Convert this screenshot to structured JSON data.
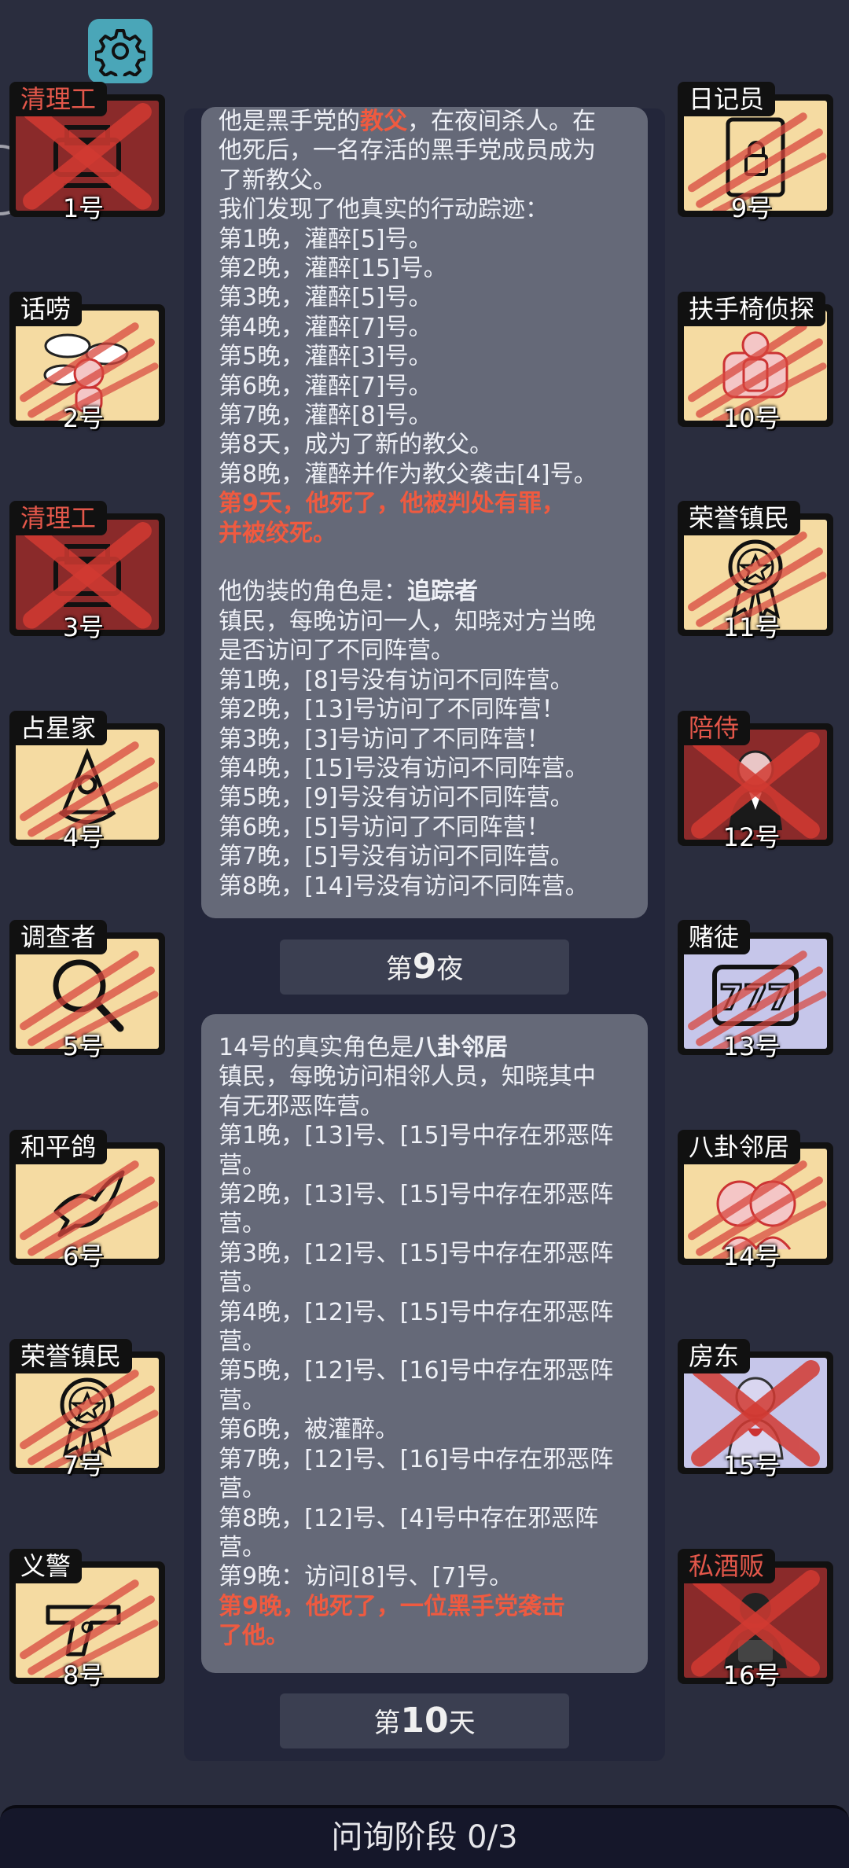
{
  "colors": {
    "background": "#2a2d3e",
    "bubble": "#656978",
    "accent_red": "#ef5a40",
    "card_bg": "#f5dba2"
  },
  "settings": {
    "icon": "gear-icon"
  },
  "left_players": [
    {
      "role": "清理工",
      "number": "1号",
      "icon": "cleaner-machine-icon",
      "dead": true,
      "role_red": true
    },
    {
      "role": "话唠",
      "number": "2号",
      "icon": "chatterbox-icon",
      "dead": false,
      "role_red": false
    },
    {
      "role": "清理工",
      "number": "3号",
      "icon": "cleaner-machine-icon",
      "dead": true,
      "role_red": true
    },
    {
      "role": "占星家",
      "number": "4号",
      "icon": "sextant-icon",
      "dead": false,
      "role_red": false
    },
    {
      "role": "调查者",
      "number": "5号",
      "icon": "magnifier-icon",
      "dead": false,
      "role_red": false
    },
    {
      "role": "和平鸽",
      "number": "6号",
      "icon": "dove-icon",
      "dead": false,
      "role_red": false
    },
    {
      "role": "荣誉镇民",
      "number": "7号",
      "icon": "medal-icon",
      "dead": false,
      "role_red": false
    },
    {
      "role": "义警",
      "number": "8号",
      "icon": "pistol-icon",
      "dead": false,
      "role_red": false
    }
  ],
  "right_players": [
    {
      "role": "日记员",
      "number": "9号",
      "icon": "diary-lock-icon",
      "dead": false,
      "role_red": false
    },
    {
      "role": "扶手椅侦探",
      "number": "10号",
      "icon": "armchair-icon",
      "dead": false,
      "role_red": false
    },
    {
      "role": "荣誉镇民",
      "number": "11号",
      "icon": "medal-icon",
      "dead": false,
      "role_red": false
    },
    {
      "role": "陪侍",
      "number": "12号",
      "icon": "escort-icon",
      "dead": true,
      "role_red": true
    },
    {
      "role": "赌徒",
      "number": "13号",
      "icon": "slot-777-icon",
      "dead": false,
      "role_red": false
    },
    {
      "role": "八卦邻居",
      "number": "14号",
      "icon": "gossip-icon",
      "dead": false,
      "role_red": false
    },
    {
      "role": "房东",
      "number": "15号",
      "icon": "landlord-icon",
      "dead": true,
      "role_red": false
    },
    {
      "role": "私酒贩",
      "number": "16号",
      "icon": "bootlegger-icon",
      "dead": true,
      "role_red": true
    }
  ],
  "log": {
    "bubble1": [
      {
        "parts": [
          {
            "t": "他是黑手党的"
          },
          {
            "t": "教父",
            "red": true
          },
          {
            "t": "，在夜间杀人。在"
          }
        ]
      },
      {
        "parts": [
          {
            "t": "他死后，一名存活的黑手党成员成为"
          }
        ]
      },
      {
        "parts": [
          {
            "t": "了新教父。"
          }
        ]
      },
      {
        "parts": [
          {
            "t": "我们发现了他真实的行动踪迹："
          }
        ]
      },
      {
        "parts": [
          {
            "t": "第1晚，灌醉[5]号。"
          }
        ]
      },
      {
        "parts": [
          {
            "t": "第2晚，灌醉[15]号。"
          }
        ]
      },
      {
        "parts": [
          {
            "t": "第3晚，灌醉[5]号。"
          }
        ]
      },
      {
        "parts": [
          {
            "t": "第4晚，灌醉[7]号。"
          }
        ]
      },
      {
        "parts": [
          {
            "t": "第5晚，灌醉[3]号。"
          }
        ]
      },
      {
        "parts": [
          {
            "t": "第6晚，灌醉[7]号。"
          }
        ]
      },
      {
        "parts": [
          {
            "t": "第7晚，灌醉[8]号。"
          }
        ]
      },
      {
        "parts": [
          {
            "t": "第8天，成为了新的教父。"
          }
        ]
      },
      {
        "parts": [
          {
            "t": "第8晚，灌醉并作为教父袭击[4]号。"
          }
        ]
      },
      {
        "parts": [
          {
            "t": "第9天，他死了，他被判处有罪，",
            "red": true
          }
        ]
      },
      {
        "parts": [
          {
            "t": "并被绞死。",
            "red": true
          }
        ]
      },
      {
        "parts": [
          {
            "t": ""
          }
        ]
      },
      {
        "parts": [
          {
            "t": "他伪装的角色是："
          },
          {
            "t": "追踪者",
            "bold": true
          }
        ]
      },
      {
        "parts": [
          {
            "t": "镇民，每晚访问一人，知晓对方当晚"
          }
        ]
      },
      {
        "parts": [
          {
            "t": "是否访问了不同阵营。"
          }
        ]
      },
      {
        "parts": [
          {
            "t": "第1晚，[8]号没有访问不同阵营。"
          }
        ]
      },
      {
        "parts": [
          {
            "t": "第2晚，[13]号访问了不同阵营！"
          }
        ]
      },
      {
        "parts": [
          {
            "t": "第3晚，[3]号访问了不同阵营！"
          }
        ]
      },
      {
        "parts": [
          {
            "t": "第4晚，[15]号没有访问不同阵营。"
          }
        ]
      },
      {
        "parts": [
          {
            "t": "第5晚，[9]号没有访问不同阵营。"
          }
        ]
      },
      {
        "parts": [
          {
            "t": "第6晚，[5]号访问了不同阵营！"
          }
        ]
      },
      {
        "parts": [
          {
            "t": "第7晚，[5]号没有访问不同阵营。"
          }
        ]
      },
      {
        "parts": [
          {
            "t": "第8晚，[14]号没有访问不同阵营。"
          }
        ]
      }
    ],
    "night_tag": {
      "prefix": "第",
      "num": "9",
      "suffix": "夜"
    },
    "bubble2": [
      {
        "parts": [
          {
            "t": "14号的真实角色是"
          },
          {
            "t": "八卦邻居",
            "bold": true
          }
        ]
      },
      {
        "parts": [
          {
            "t": "镇民，每晚访问相邻人员，知晓其中"
          }
        ]
      },
      {
        "parts": [
          {
            "t": "有无邪恶阵营。"
          }
        ]
      },
      {
        "parts": [
          {
            "t": "第1晚，[13]号、[15]号中存在邪恶阵"
          }
        ]
      },
      {
        "parts": [
          {
            "t": "营。"
          }
        ]
      },
      {
        "parts": [
          {
            "t": "第2晚，[13]号、[15]号中存在邪恶阵"
          }
        ]
      },
      {
        "parts": [
          {
            "t": "营。"
          }
        ]
      },
      {
        "parts": [
          {
            "t": "第3晚，[12]号、[15]号中存在邪恶阵"
          }
        ]
      },
      {
        "parts": [
          {
            "t": "营。"
          }
        ]
      },
      {
        "parts": [
          {
            "t": "第4晚，[12]号、[15]号中存在邪恶阵"
          }
        ]
      },
      {
        "parts": [
          {
            "t": "营。"
          }
        ]
      },
      {
        "parts": [
          {
            "t": "第5晚，[12]号、[16]号中存在邪恶阵"
          }
        ]
      },
      {
        "parts": [
          {
            "t": "营。"
          }
        ]
      },
      {
        "parts": [
          {
            "t": "第6晚，被灌醉。"
          }
        ]
      },
      {
        "parts": [
          {
            "t": "第7晚，[12]号、[16]号中存在邪恶阵"
          }
        ]
      },
      {
        "parts": [
          {
            "t": "营。"
          }
        ]
      },
      {
        "parts": [
          {
            "t": "第8晚，[12]号、[4]号中存在邪恶阵"
          }
        ]
      },
      {
        "parts": [
          {
            "t": "营。"
          }
        ]
      },
      {
        "parts": [
          {
            "t": "第9晚：访问[8]号、[7]号。"
          }
        ]
      },
      {
        "parts": [
          {
            "t": "第9晚，他死了，一位黑手党袭击",
            "red": true
          }
        ]
      },
      {
        "parts": [
          {
            "t": "了他。",
            "red": true
          }
        ]
      }
    ],
    "day_tag": {
      "prefix": "第",
      "num": "10",
      "suffix": "天"
    }
  },
  "bottom_bar": {
    "label": "问询阶段 0/3"
  }
}
